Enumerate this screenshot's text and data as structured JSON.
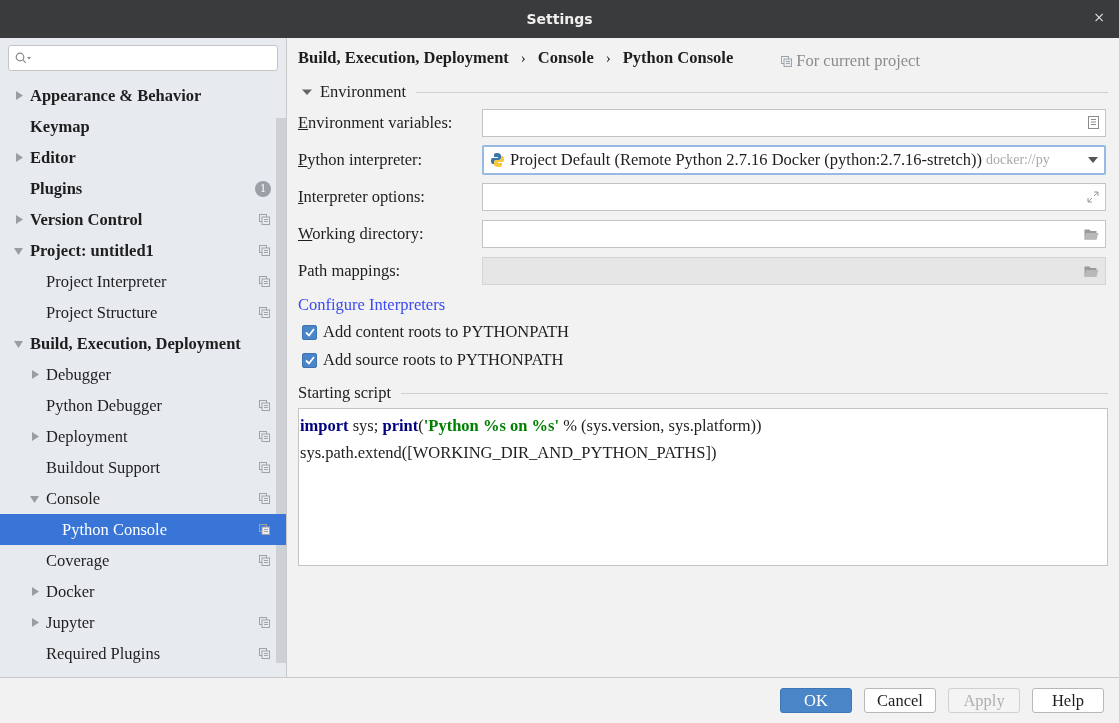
{
  "window": {
    "title": "Settings",
    "close": "×"
  },
  "sidebar": {
    "items": [
      {
        "label": "Appearance & Behavior",
        "kind": "folder",
        "expanded": false,
        "selected": false,
        "project_scoped": false
      },
      {
        "label": "Keymap",
        "kind": "page",
        "selected": false,
        "project_scoped": false
      },
      {
        "label": "Editor",
        "kind": "folder",
        "expanded": false,
        "selected": false,
        "project_scoped": false
      },
      {
        "label": "Plugins",
        "kind": "page",
        "selected": false,
        "project_scoped": false,
        "badge": "1"
      },
      {
        "label": "Version Control",
        "kind": "folder",
        "expanded": false,
        "selected": false,
        "project_scoped": true
      },
      {
        "label": "Project: untitled1",
        "kind": "folder",
        "expanded": true,
        "selected": false,
        "project_scoped": true,
        "children": [
          {
            "label": "Project Interpreter",
            "kind": "page",
            "selected": false,
            "project_scoped": true
          },
          {
            "label": "Project Structure",
            "kind": "page",
            "selected": false,
            "project_scoped": true
          }
        ]
      },
      {
        "label": "Build, Execution, Deployment",
        "kind": "folder",
        "expanded": true,
        "selected": false,
        "project_scoped": false,
        "children": [
          {
            "label": "Debugger",
            "kind": "folder",
            "expanded": false,
            "selected": false,
            "project_scoped": false
          },
          {
            "label": "Python Debugger",
            "kind": "page",
            "selected": false,
            "project_scoped": true
          },
          {
            "label": "Deployment",
            "kind": "folder",
            "expanded": false,
            "selected": false,
            "project_scoped": true
          },
          {
            "label": "Buildout Support",
            "kind": "page",
            "selected": false,
            "project_scoped": true
          },
          {
            "label": "Console",
            "kind": "folder",
            "expanded": true,
            "selected": false,
            "project_scoped": true,
            "children": [
              {
                "label": "Python Console",
                "kind": "page",
                "selected": true,
                "project_scoped": true
              }
            ]
          },
          {
            "label": "Coverage",
            "kind": "page",
            "selected": false,
            "project_scoped": true
          },
          {
            "label": "Docker",
            "kind": "folder",
            "expanded": false,
            "selected": false,
            "project_scoped": false
          },
          {
            "label": "Jupyter",
            "kind": "folder",
            "expanded": false,
            "selected": false,
            "project_scoped": true
          },
          {
            "label": "Required Plugins",
            "kind": "page",
            "selected": false,
            "project_scoped": true
          }
        ]
      }
    ]
  },
  "breadcrumb": {
    "parts": [
      "Build, Execution, Deployment",
      "Console",
      "Python Console"
    ],
    "separator": "›",
    "scope": "For current project"
  },
  "environment": {
    "title": "Environment",
    "expanded": true,
    "fields": [
      {
        "label": "Environment variables:",
        "underline_first": true,
        "kind": "envvars",
        "disabled": false
      },
      {
        "label": "Python interpreter:",
        "underline_first": true,
        "kind": "dropdown",
        "value": "Project Default (Remote Python 2.7.16 Docker (python:2.7.16-stretch))",
        "hint": "docker://py",
        "focused": true,
        "disabled": false
      },
      {
        "label": "Interpreter options:",
        "underline_first": true,
        "kind": "options",
        "disabled": false
      },
      {
        "label": "Working directory:",
        "underline_first": true,
        "kind": "directory",
        "disabled": false
      },
      {
        "label": "Path mappings:",
        "underline_first": false,
        "kind": "directory",
        "disabled": true
      }
    ],
    "link": "Configure Interpreters",
    "checkboxes": [
      {
        "label": "Add content roots to PYTHONPATH",
        "checked": true
      },
      {
        "label": "Add source roots to PYTHONPATH",
        "checked": true
      }
    ]
  },
  "starting_script": {
    "title": "Starting script",
    "lines": [
      [
        {
          "text": "import",
          "kind": "keyword"
        },
        {
          "text": " sys; ",
          "kind": "plain"
        },
        {
          "text": "print",
          "kind": "keyword"
        },
        {
          "text": "(",
          "kind": "plain"
        },
        {
          "text": "'Python %s on %s'",
          "kind": "string"
        },
        {
          "text": " % (sys.version, sys.platform))",
          "kind": "plain"
        }
      ],
      [
        {
          "text": "sys.path.extend([WORKING_DIR_AND_PYTHON_PATHS])",
          "kind": "plain"
        }
      ]
    ]
  },
  "buttons": [
    {
      "label": "OK",
      "kind": "primary",
      "disabled": false
    },
    {
      "label": "Cancel",
      "kind": "normal",
      "disabled": false
    },
    {
      "label": "Apply",
      "kind": "normal",
      "disabled": true
    },
    {
      "label": "Help",
      "kind": "normal",
      "disabled": false
    }
  ]
}
